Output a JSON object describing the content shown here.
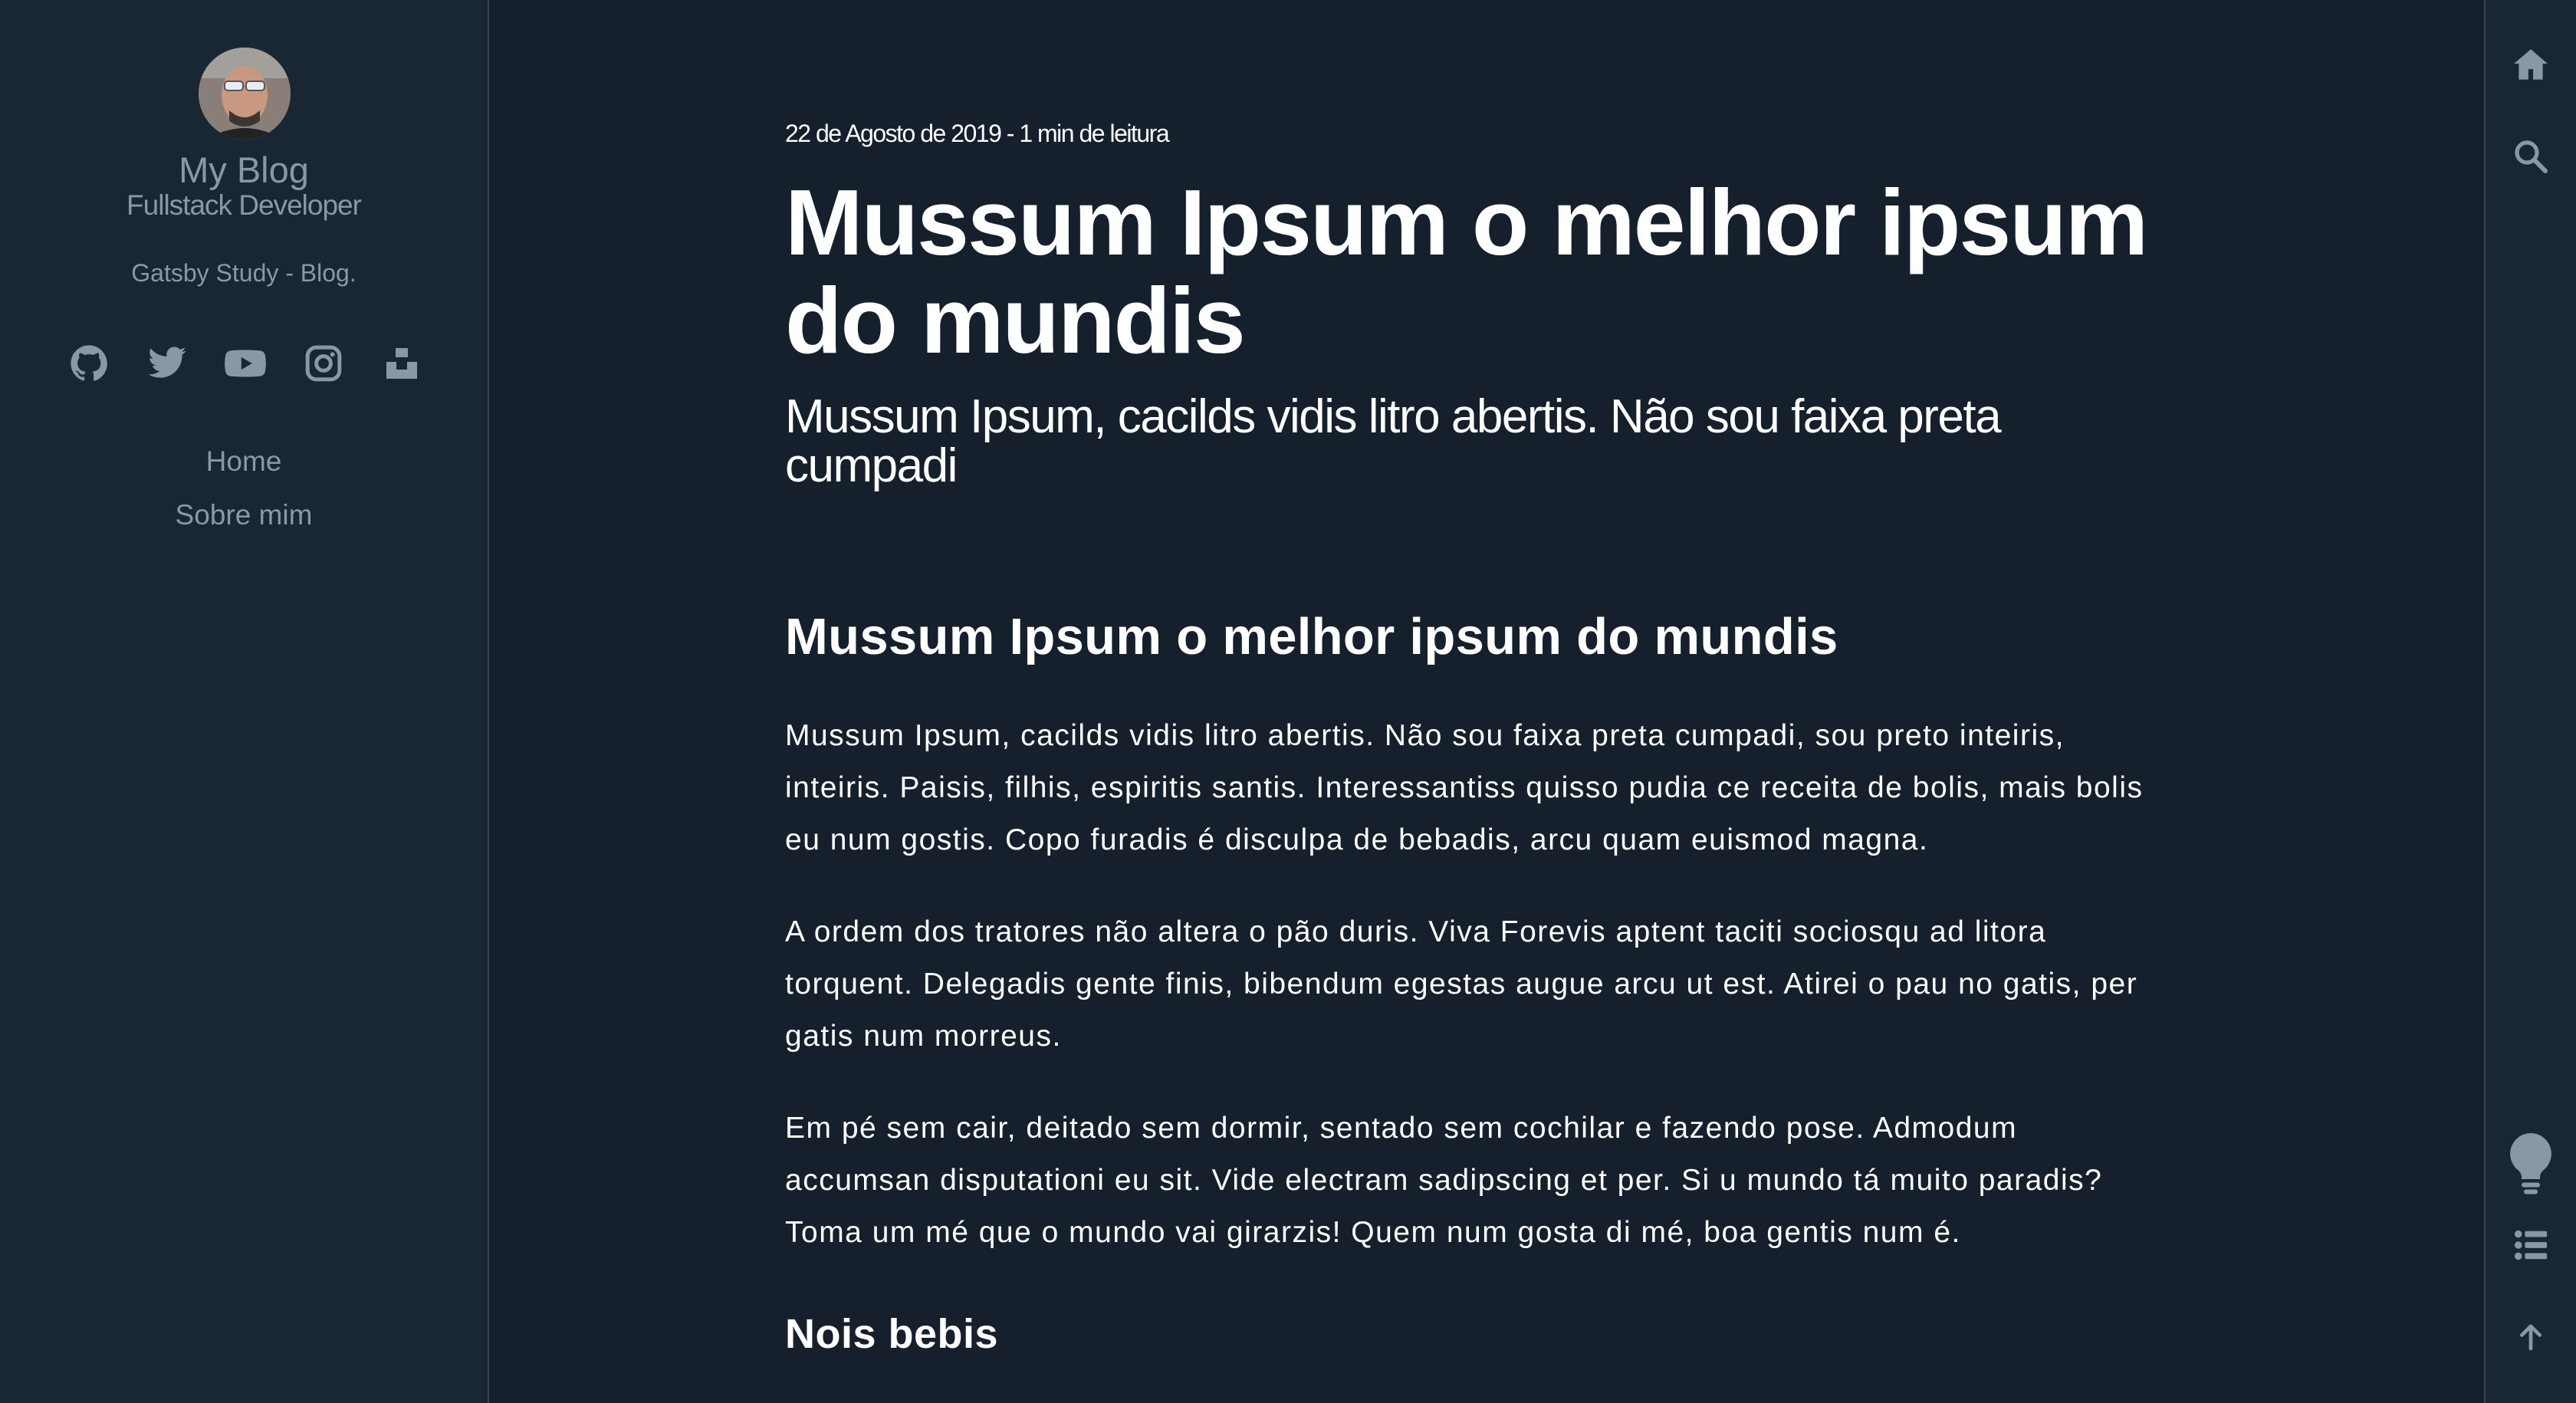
{
  "sidebar": {
    "title": "My Blog",
    "subtitle": "Fullstack Developer",
    "description": "Gatsby Study - Blog.",
    "social": [
      {
        "name": "github",
        "icon": "github-icon"
      },
      {
        "name": "twitter",
        "icon": "twitter-icon"
      },
      {
        "name": "youtube",
        "icon": "youtube-icon"
      },
      {
        "name": "instagram",
        "icon": "instagram-icon"
      },
      {
        "name": "unsplash",
        "icon": "unsplash-icon"
      }
    ],
    "nav": [
      {
        "label": "Home"
      },
      {
        "label": "Sobre mim"
      }
    ]
  },
  "post": {
    "meta": "22 de Agosto de 2019 - 1 min de leitura",
    "title": "Mussum Ipsum o melhor ipsum do mundis",
    "description": "Mussum Ipsum, cacilds vidis litro abertis. Não sou faixa preta cumpadi",
    "heading": "Mussum Ipsum o melhor ipsum do mundis",
    "paragraphs": [
      "Mussum Ipsum, cacilds vidis litro abertis. Não sou faixa preta cumpadi, sou preto inteiris, inteiris. Paisis, filhis, espiritis santis. Interessantiss quisso pudia ce receita de bolis, mais bolis eu num gostis. Copo furadis é disculpa de bebadis, arcu quam euismod magna.",
      "A ordem dos tratores não altera o pão duris. Viva Forevis aptent taciti sociosqu ad litora torquent. Delegadis gente finis, bibendum egestas augue arcu ut est. Atirei o pau no gatis, per gatis num morreus.",
      "Em pé sem cair, deitado sem dormir, sentado sem cochilar e fazendo pose. Admodum accumsan disputationi eu sit. Vide electram sadipscing et per. Si u mundo tá muito paradis? Toma um mé que o mundo vai girarzis! Quem num gosta di mé, boa gentis num é."
    ],
    "subheading": "Nois bebis"
  },
  "menubar": {
    "top": [
      {
        "icon": "home-icon"
      },
      {
        "icon": "search-icon"
      }
    ],
    "bottom": [
      {
        "icon": "lightbulb-icon"
      },
      {
        "icon": "list-icon"
      },
      {
        "icon": "arrow-up-icon"
      }
    ]
  },
  "colors": {
    "background": "#16202c",
    "sidebar_background": "#192734",
    "border": "#38444d",
    "muted_text": "#8899a6",
    "text": "#ffffff"
  }
}
